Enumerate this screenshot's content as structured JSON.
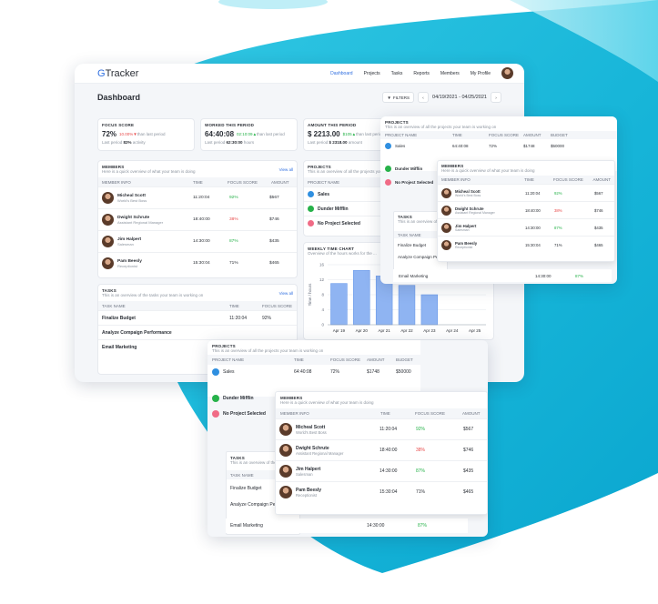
{
  "app": {
    "logo_g": "G",
    "logo_rest": "Tracker",
    "nav": [
      "Dashboard",
      "Projects",
      "Tasks",
      "Reports",
      "Members",
      "My Profile"
    ]
  },
  "colors": {
    "accent": "#2f6fe0",
    "green": "#27b24a",
    "red": "#e84a4a",
    "orange": "#f28a2a",
    "bar": "#8fb4f2"
  },
  "dashboard": {
    "title": "Dashboard",
    "filters_label": "FILTERS",
    "date_range": "04/19/2021 - 04/25/2021"
  },
  "stats": [
    {
      "label": "FOCUS SCORE",
      "value": "72%",
      "delta": "10.00%",
      "delta_dir": "down",
      "delta_suffix": "than last period",
      "sub_prefix": "Last period",
      "sub_value": "82%",
      "sub_suffix": "activity"
    },
    {
      "label": "WORKED THIS PERIOD",
      "value": "64:40:08",
      "delta": "02:10:09",
      "delta_dir": "up",
      "delta_suffix": "than last period",
      "sub_prefix": "Last period",
      "sub_value": "62:30:00",
      "sub_suffix": "hours"
    },
    {
      "label": "AMOUNT THIS PERIOD",
      "value": "$ 2213.00",
      "delta": "$105",
      "delta_dir": "up",
      "delta_suffix": "than last period",
      "sub_prefix": "Last period",
      "sub_value": "$ 2318.00",
      "sub_suffix": "amount"
    }
  ],
  "members": {
    "title": "MEMBERS",
    "subtitle": "Here is a quick overview of what your team is doing",
    "view_all": "View all",
    "cols": [
      "MEMBER INFO",
      "TIME",
      "FOCUS SCORE",
      "AMOUNT"
    ],
    "rows": [
      {
        "name": "Micheal Scott",
        "role": "World's Best Boss",
        "time": "11:20:04",
        "focus": "92%",
        "focus_color": "green",
        "amount": "$567"
      },
      {
        "name": "Dwight Schrute",
        "role": "Assistant Regional Manager",
        "time": "18:40:00",
        "focus": "38%",
        "focus_color": "red",
        "amount": "$746"
      },
      {
        "name": "Jim Halpert",
        "role": "Salesman",
        "time": "14:30:00",
        "focus": "87%",
        "focus_color": "green",
        "amount": "$435"
      },
      {
        "name": "Pam Beesly",
        "role": "Receptionist",
        "time": "15:30:04",
        "focus": "71%",
        "focus_color": "plain",
        "amount": "$465"
      }
    ]
  },
  "tasks": {
    "title": "TASKS",
    "subtitle": "This is an overview of the tasks your team is working on",
    "view_all": "View all",
    "cols": [
      "TASK NAME",
      "TIME",
      "FOCUS SCORE"
    ],
    "rows": [
      {
        "name": "Finalize Budget",
        "time": "11:20:04",
        "focus": "92%"
      },
      {
        "name": "Analyze Compaign Performance",
        "time": "",
        "focus": ""
      },
      {
        "name": "Email Marketing",
        "time": "14:30:00",
        "focus": "87%"
      }
    ]
  },
  "projects": {
    "title": "PROJECTS",
    "subtitle": "This is an overview of all the projects your team is working on",
    "cols": [
      "PROJECT NAME",
      "TIME",
      "FOCUS SCORE",
      "AMOUNT",
      "BUDGET"
    ],
    "rows": [
      {
        "name": "Sales",
        "color": "#2f8fe0",
        "time": "64:40:08",
        "focus": "72%",
        "amount": "$1748",
        "budget": "$50000"
      },
      {
        "name": "Dunder Mifflin",
        "color": "#27b24a",
        "time": "",
        "focus": "",
        "amount": "",
        "budget": ""
      },
      {
        "name": "No Project Selected",
        "color": "#f06b86",
        "time": "",
        "focus": "",
        "amount": "",
        "budget": ""
      }
    ]
  },
  "chart_data": {
    "type": "bar",
    "title": "WEEKLY TIME CHART",
    "subtitle": "Overview of the hours works for the ...",
    "ylabel": "Time / hours",
    "categories": [
      "Apr 19",
      "Apr 20",
      "Apr 21",
      "Apr 22",
      "Apr 23",
      "Apr 24",
      "Apr 25"
    ],
    "values": [
      11,
      14.5,
      13,
      10.5,
      8,
      0,
      0
    ],
    "ylim": [
      0,
      16
    ],
    "yticks": [
      0,
      4,
      8,
      12,
      16
    ],
    "grid": true
  }
}
